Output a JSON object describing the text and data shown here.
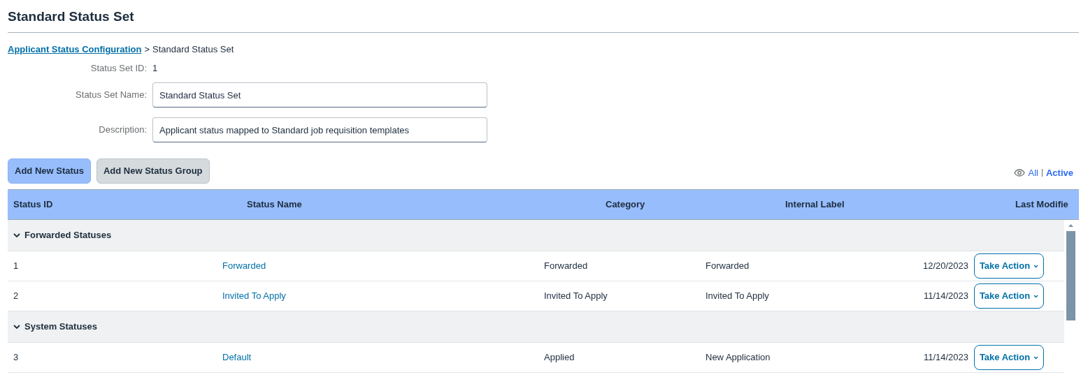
{
  "page_title": "Standard Status Set",
  "breadcrumb": {
    "link": "Applicant Status Configuration",
    "separator": ">",
    "current": "Standard Status Set"
  },
  "form": {
    "id_label": "Status Set ID:",
    "id_value": "1",
    "fields": [
      {
        "label": "Status Set Name:",
        "value": "Standard Status Set"
      },
      {
        "label": "Description:",
        "value": "Applicant status mapped to Standard job requisition templates"
      }
    ]
  },
  "buttons": [
    {
      "label": "Add New Status",
      "kind": "primary"
    },
    {
      "label": "Add New Status Group",
      "kind": "secondary"
    }
  ],
  "filter": [
    {
      "label": "All",
      "selected": false
    },
    {
      "label": "Active",
      "selected": true
    }
  ],
  "table": {
    "columns": [
      "Status ID",
      "Status Name",
      "Category",
      "Internal Label",
      "Last Modifie"
    ],
    "groups": [
      {
        "name": "Forwarded Statuses",
        "expanded": true,
        "rows": [
          {
            "id": "1",
            "name": "Forwarded",
            "category": "Forwarded",
            "internal_label": "Forwarded",
            "last_modified": "12/20/2023",
            "action": "Take Action"
          },
          {
            "id": "2",
            "name": "Invited To Apply",
            "category": "Invited To Apply",
            "internal_label": "Invited To Apply",
            "last_modified": "11/14/2023",
            "action": "Take Action"
          }
        ]
      },
      {
        "name": "System Statuses",
        "expanded": true,
        "rows": [
          {
            "id": "3",
            "name": "Default",
            "category": "Applied",
            "internal_label": "New Application",
            "last_modified": "11/14/2023",
            "action": "Take Action"
          }
        ]
      }
    ]
  }
}
